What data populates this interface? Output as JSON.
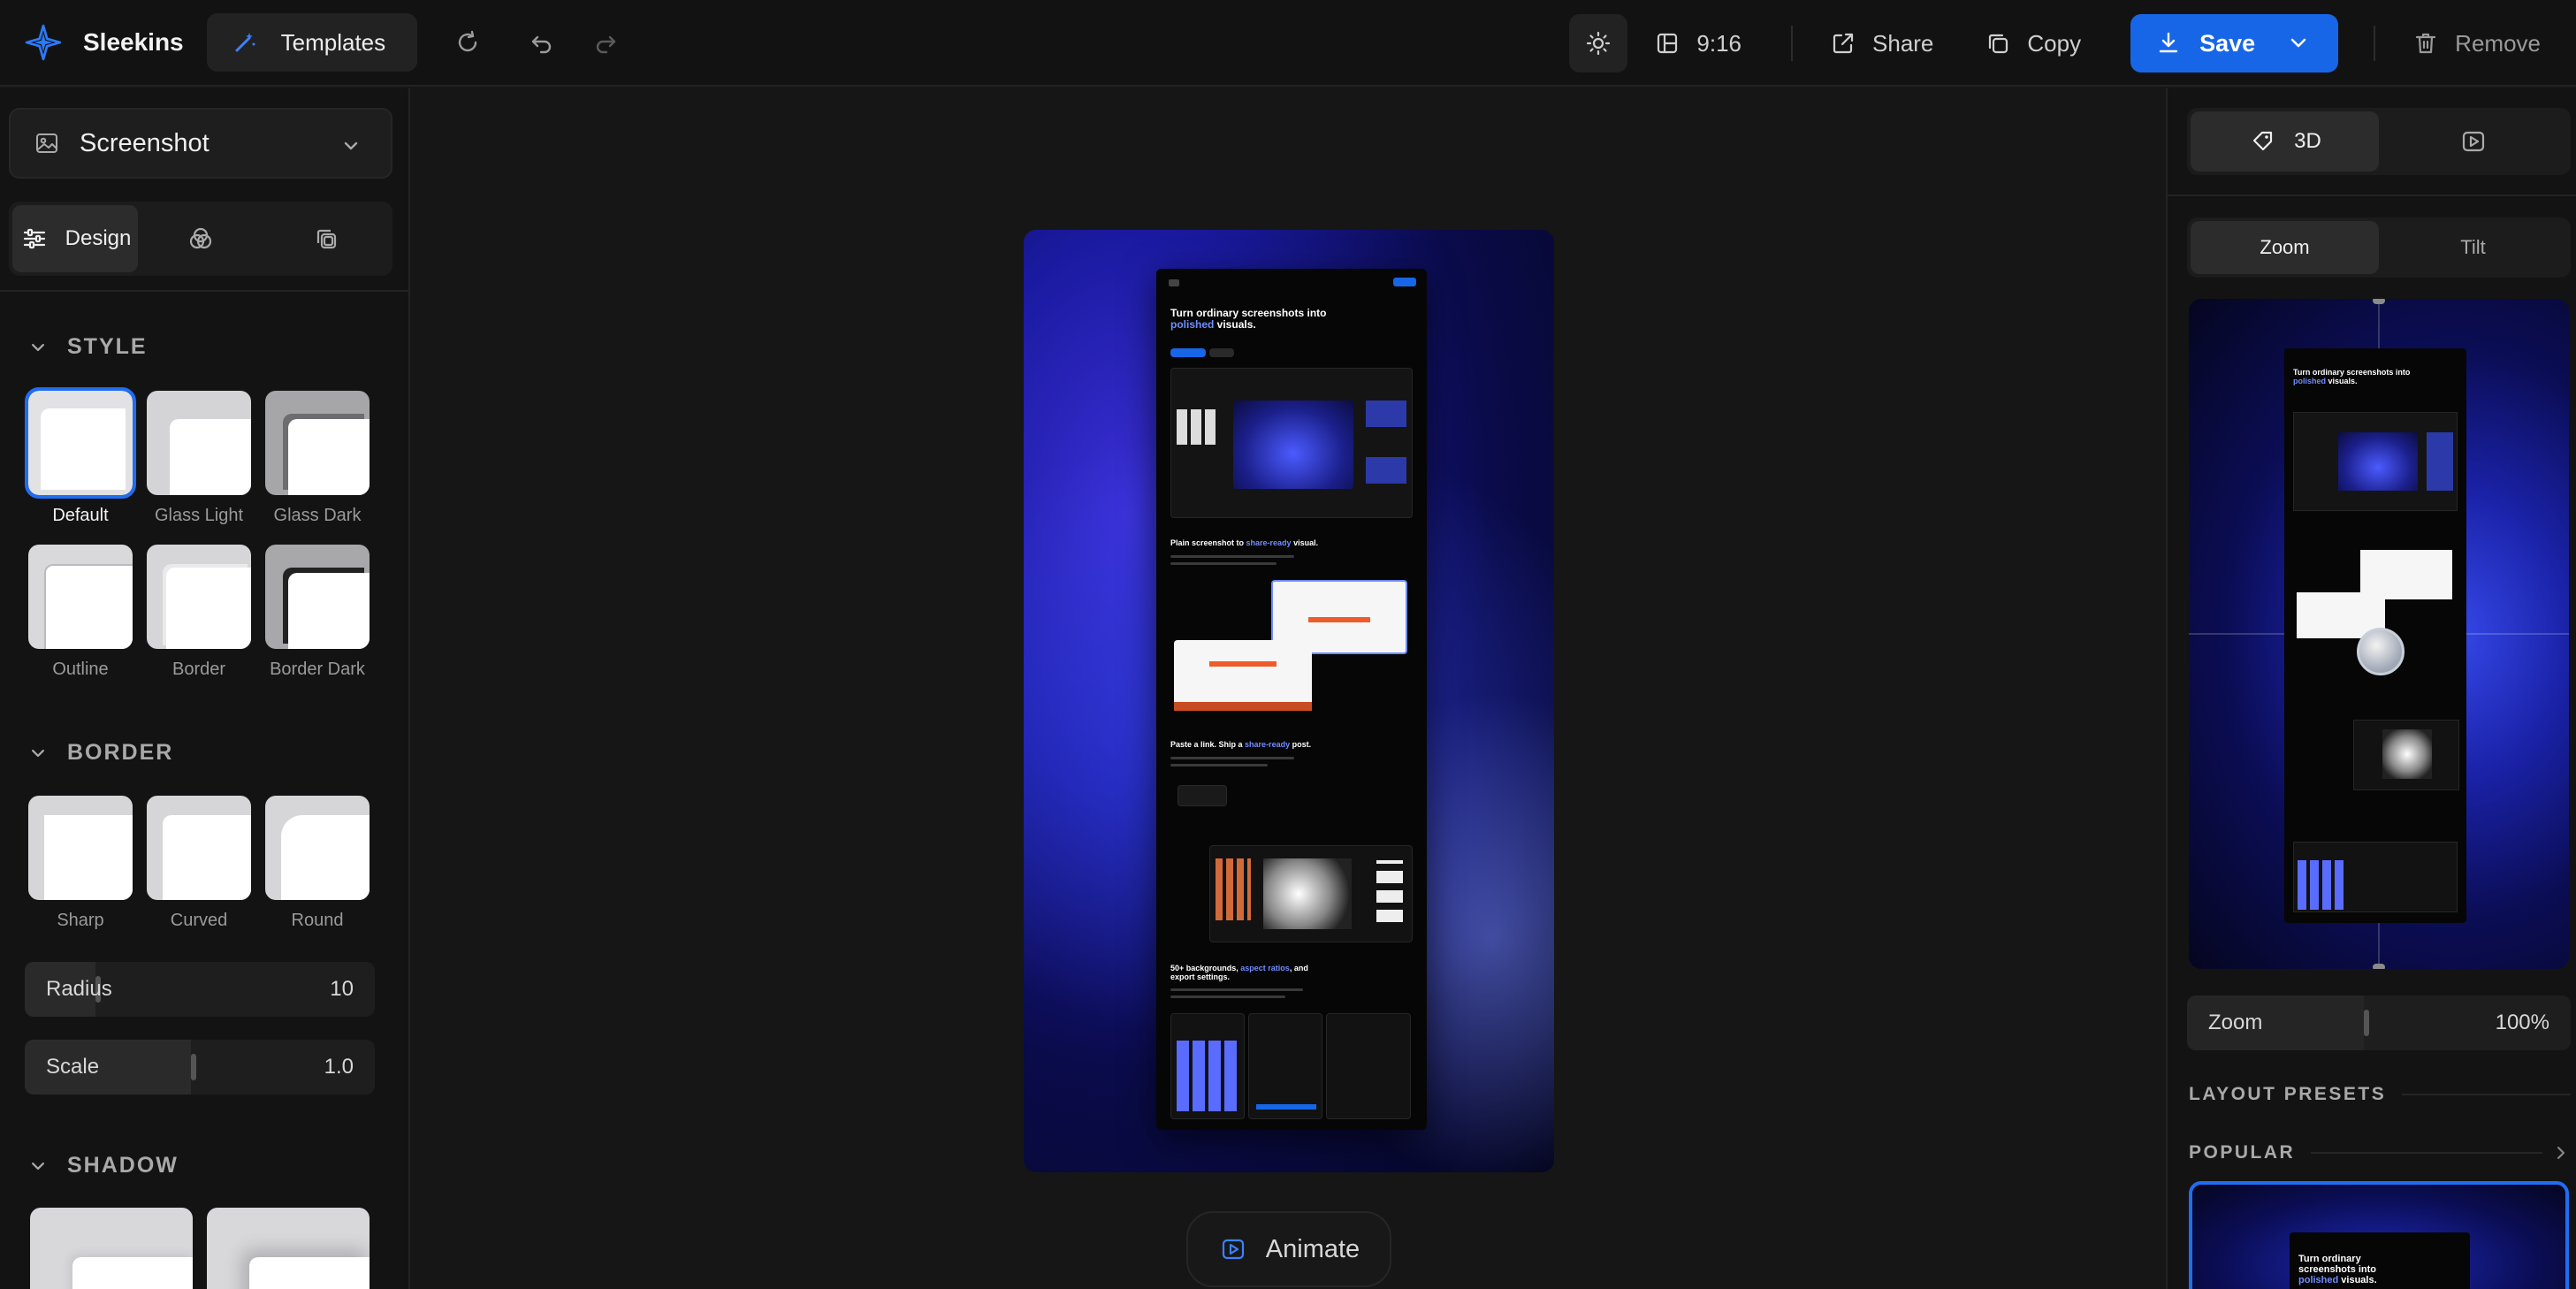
{
  "app": {
    "name": "Sleekins",
    "templates_label": "Templates"
  },
  "topbar": {
    "aspect_label": "9:16",
    "share_label": "Share",
    "copy_label": "Copy",
    "save_label": "Save",
    "remove_label": "Remove"
  },
  "left": {
    "asset_select": "Screenshot",
    "tabs": [
      {
        "label": "Design",
        "icon": "sliders-icon",
        "active": true
      },
      {
        "label": "",
        "icon": "circles-blend-icon",
        "active": false
      },
      {
        "label": "",
        "icon": "layers-copy-icon",
        "active": false
      }
    ],
    "style": {
      "title": "STYLE",
      "items": [
        "Default",
        "Glass Light",
        "Glass Dark",
        "Outline",
        "Border",
        "Border Dark"
      ],
      "selected": "Default"
    },
    "border": {
      "title": "BORDER",
      "items": [
        "Sharp",
        "Curved",
        "Round"
      ]
    },
    "radius": {
      "label": "Radius",
      "value": "10"
    },
    "scale": {
      "label": "Scale",
      "value": "1.0"
    },
    "shadow": {
      "title": "SHADOW"
    }
  },
  "canvas": {
    "headings": [
      {
        "pre": "Turn ordinary screenshots into ",
        "hl": "polished",
        "post": " visuals."
      },
      {
        "pre": "Plain screenshot to ",
        "hl": "share-ready",
        "post": " visual."
      },
      {
        "pre": "Paste a link. Ship a ",
        "hl": "share-ready",
        "post": " post."
      },
      {
        "pre": "50+ backgrounds, ",
        "hl": "aspect ratios",
        "post": ", and export settings."
      }
    ],
    "animate_label": "Animate"
  },
  "right": {
    "mode_tabs": [
      {
        "label": "3D",
        "icon": "tag-3d-icon",
        "active": true
      },
      {
        "label": "",
        "icon": "video-icon",
        "active": false
      }
    ],
    "sub_tabs": [
      {
        "label": "Zoom",
        "active": true
      },
      {
        "label": "Tilt",
        "active": false
      }
    ],
    "zoom": {
      "label": "Zoom",
      "value": "100%"
    },
    "layout_presets_title": "LAYOUT PRESETS",
    "popular_title": "POPULAR",
    "popular_heading_pre": "Turn ordinary screenshots into ",
    "popular_heading_hl": "polished",
    "popular_heading_post": " visuals."
  },
  "colors": {
    "accent": "#1766e8",
    "highlight": "#6f8dff",
    "bg": "#161616",
    "panel": "#131313"
  }
}
